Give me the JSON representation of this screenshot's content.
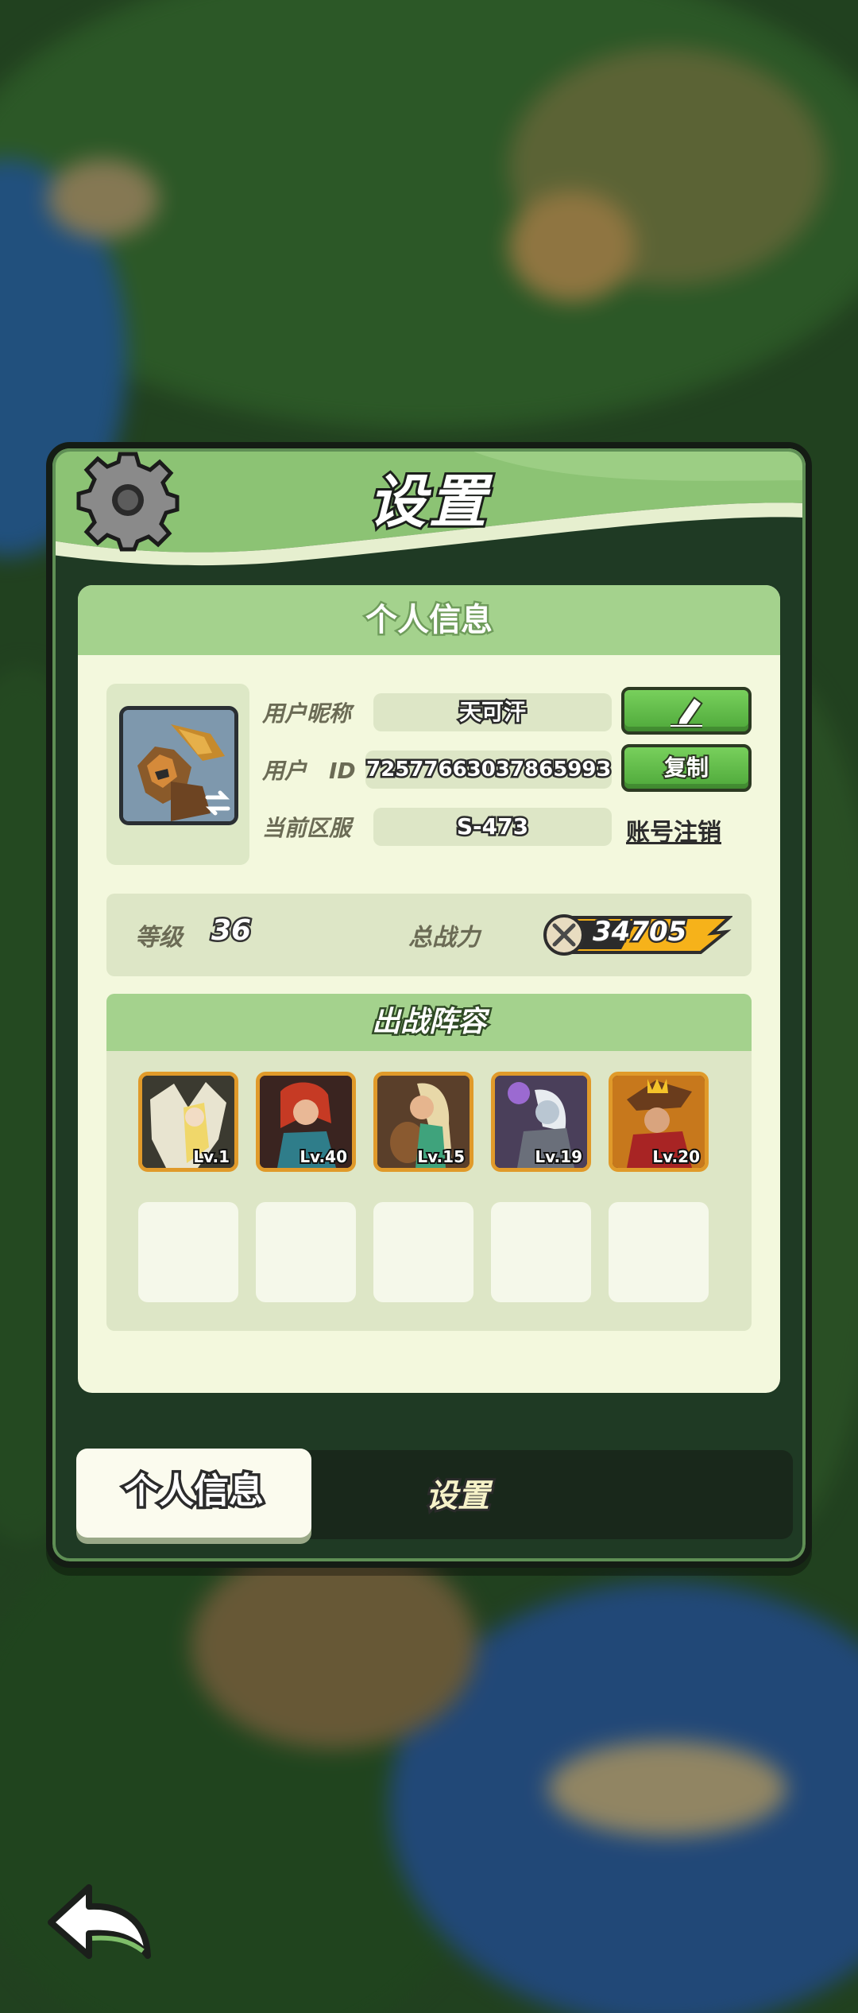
{
  "dialog": {
    "title": "设置",
    "section_title": "个人信息"
  },
  "profile": {
    "nickname_label": "用户昵称",
    "nickname_value": "天可汗",
    "user_id_label": "用户　ID",
    "user_id_value": "7257766303786599З",
    "server_label": "当前区服",
    "server_value": "S-473",
    "copy_button": "复制",
    "cancel_account_link": "账号注销"
  },
  "stats": {
    "level_label": "等级",
    "level_value": "36",
    "power_label": "总战力",
    "power_value": "34705"
  },
  "lineup": {
    "title": "出战阵容",
    "heroes": [
      {
        "level": "Lv.1"
      },
      {
        "level": "Lv.40"
      },
      {
        "level": "Lv.15"
      },
      {
        "level": "Lv.19"
      },
      {
        "level": "Lv.20"
      }
    ]
  },
  "tabs": {
    "active": "个人信息",
    "inactive": "设置"
  },
  "icons": [
    "gear-icon",
    "edit-pencil-icon",
    "swap-icon",
    "sword-icon",
    "back-arrow-icon"
  ],
  "colors": {
    "panel_green": "#1f3a24",
    "header_green": "#a4d28d",
    "card_bg": "#f3f8dd",
    "button_green": "#5cb944",
    "hero_frame": "#e09a2a"
  }
}
